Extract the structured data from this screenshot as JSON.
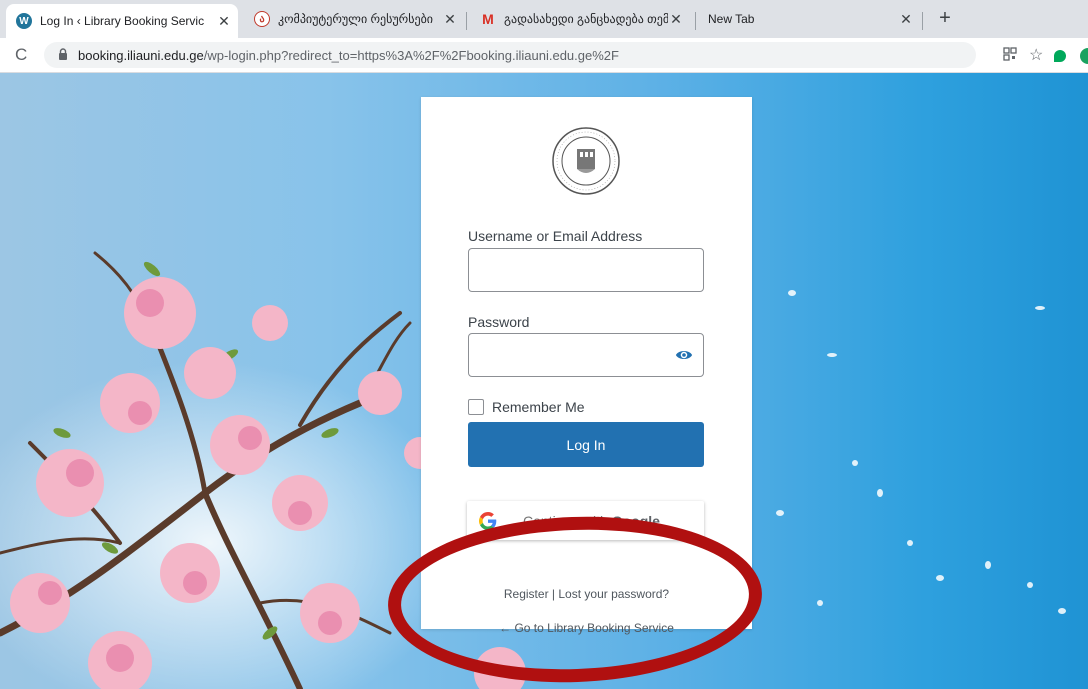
{
  "browser": {
    "tabs": [
      {
        "title": "Log In ‹ Library Booking Servic",
        "favicon": "wordpress-icon",
        "active": true
      },
      {
        "title": "კომპიუტერული რესურსები",
        "favicon": "university-seal-icon",
        "active": false
      },
      {
        "title": "გადასახედი განცხადება თემ",
        "favicon": "gmail-icon",
        "active": false
      },
      {
        "title": "New Tab",
        "favicon": "",
        "active": false
      }
    ],
    "url_host": "booking.iliauni.edu.ge",
    "url_path": "/wp-login.php?redirect_to=https%3A%2F%2Fbooking.iliauni.edu.ge%2F"
  },
  "login": {
    "username_label": "Username or Email Address",
    "username_value": "",
    "password_label": "Password",
    "password_value": "",
    "remember_label": "Remember Me",
    "login_button": "Log In",
    "google_button_prefix": "Continue with ",
    "google_button_brand": "Google",
    "register_link": "Register",
    "separator": "|",
    "lost_password_link": "Lost your password?",
    "back_link": "← Go to Library Booking Service"
  },
  "colors": {
    "primary_button": "#2271b1",
    "annotation": "#b01010"
  }
}
